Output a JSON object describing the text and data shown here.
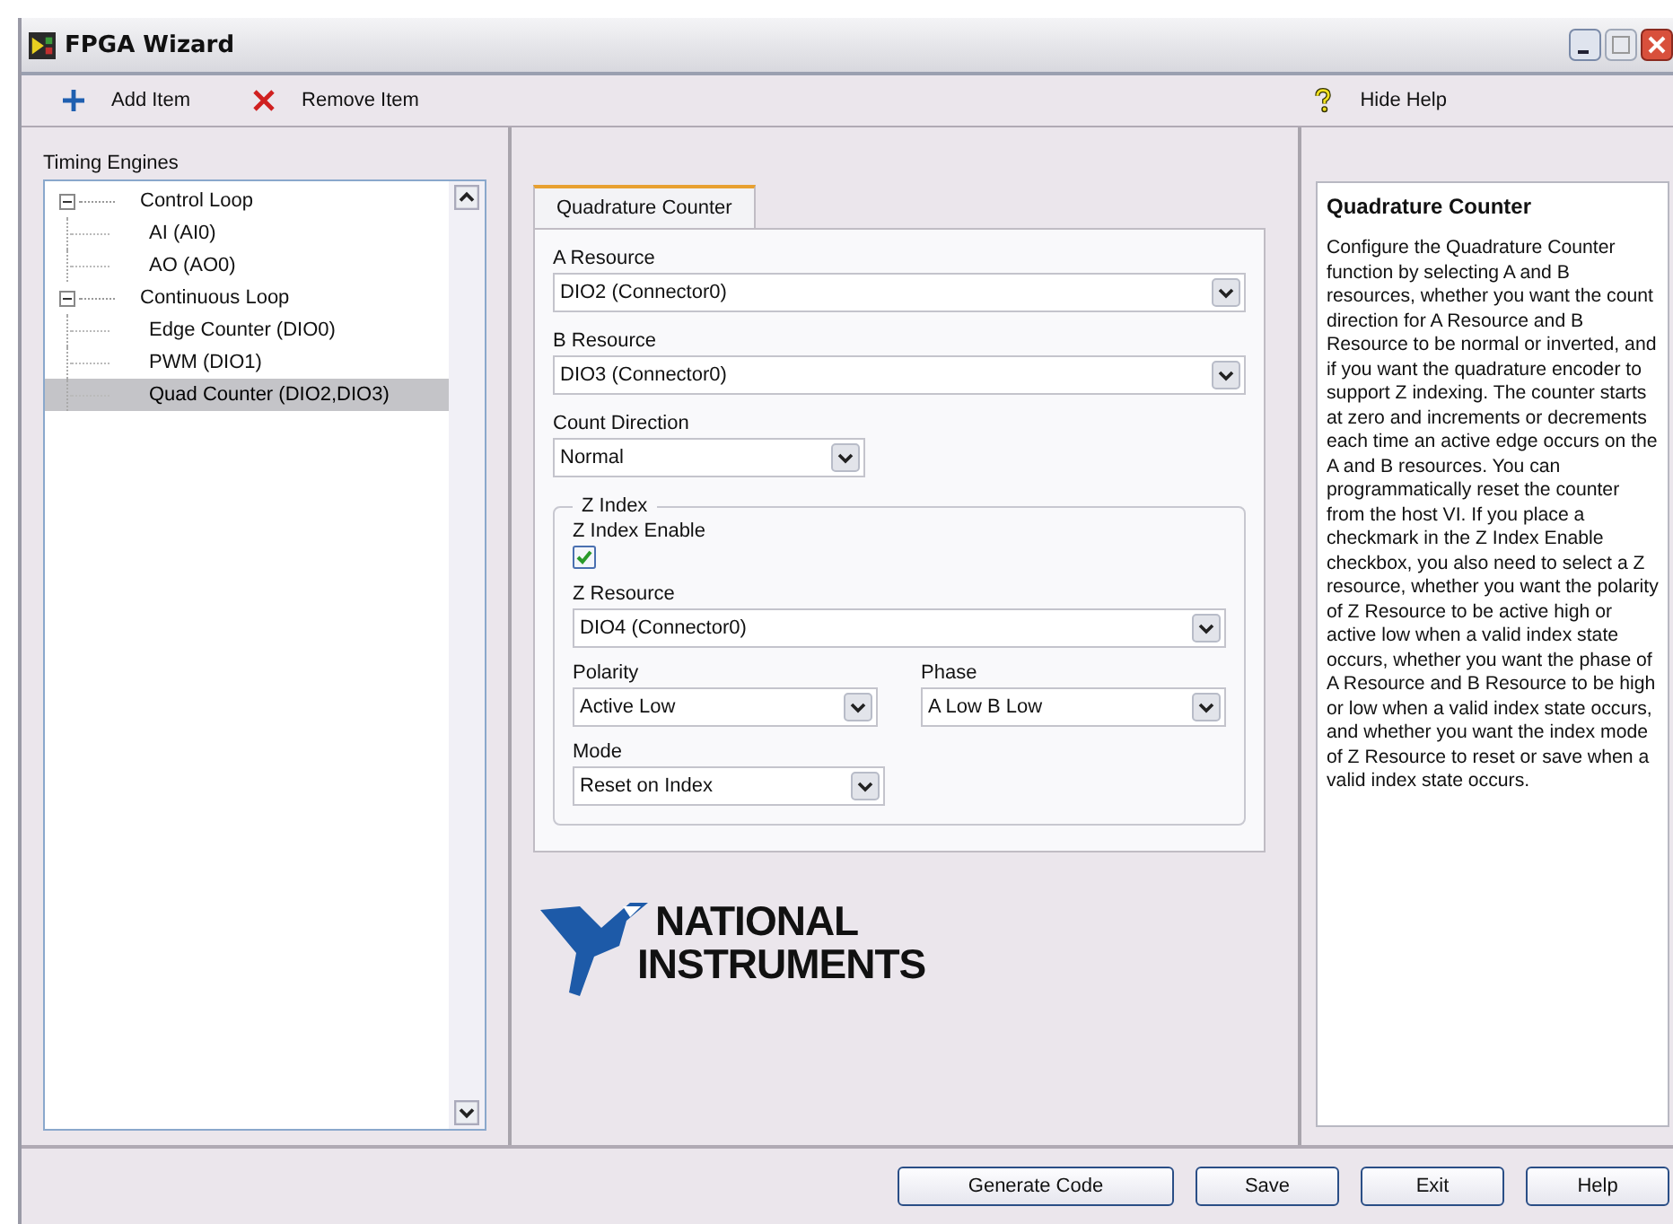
{
  "window": {
    "title": "FPGA Wizard"
  },
  "toolbar": {
    "left": [
      {
        "kind": "add",
        "label": "Add Item"
      },
      {
        "kind": "remove",
        "label": "Remove Item"
      }
    ],
    "right": {
      "kind": "help",
      "label": "Hide Help"
    }
  },
  "tree": {
    "title": "Timing Engines",
    "items": [
      {
        "label": "Control Loop",
        "expanded": true,
        "selected": false,
        "children": [
          {
            "label": "AI (AI0)",
            "selected": false
          },
          {
            "label": "AO (AO0)",
            "selected": false
          }
        ]
      },
      {
        "label": "Continuous Loop",
        "expanded": true,
        "selected": false,
        "children": [
          {
            "label": "Edge Counter (DIO0)",
            "selected": false
          },
          {
            "label": "PWM (DIO1)",
            "selected": false
          },
          {
            "label": "Quad Counter (DIO2,DIO3)",
            "selected": true
          }
        ]
      }
    ]
  },
  "tabs": [
    {
      "label": "Quadrature Counter",
      "selected": true
    }
  ],
  "form": {
    "fields": [
      {
        "label": "A Resource",
        "value": "DIO2 (Connector0)",
        "kind": "wide"
      },
      {
        "label": "B Resource",
        "value": "DIO3 (Connector0)",
        "kind": "wide"
      },
      {
        "label": "Count Direction",
        "value": "Normal",
        "kind": "narrow"
      }
    ],
    "group": {
      "title": "Z Index",
      "checkbox": {
        "label": "Z Index Enable",
        "checked": true
      },
      "z_resource": {
        "label": "Z Resource",
        "value": "DIO4 (Connector0)"
      },
      "pair": [
        {
          "label": "Polarity",
          "value": "Active Low"
        },
        {
          "label": "Phase",
          "value": "A Low B Low"
        }
      ],
      "mode": {
        "label": "Mode",
        "value": "Reset on Index"
      }
    }
  },
  "logo": {
    "line1": "NATIONAL",
    "line2": "INSTRUMENTS"
  },
  "help": {
    "title": "Quadrature Counter",
    "text": "Configure the Quadrature Counter function by selecting A and B resources, whether you want the count direction for A Resource and B Resource to be normal or inverted, and if you want the quadrature encoder to support Z indexing. The counter starts at zero and increments or decrements each time an active edge occurs on the A and B resources. You can programmatically reset the counter from the host VI. If you place a checkmark in the Z Index Enable checkbox, you also need to select a Z resource, whether you want the polarity of Z Resource to be active high or active low when a valid index state occurs, whether you want the phase of A Resource and B Resource to be high or low when a valid index state occurs, and whether you want the index mode of Z Resource to reset or save when a valid index state occurs."
  },
  "buttons": [
    "Generate Code",
    "Save",
    "Exit",
    "Help"
  ]
}
